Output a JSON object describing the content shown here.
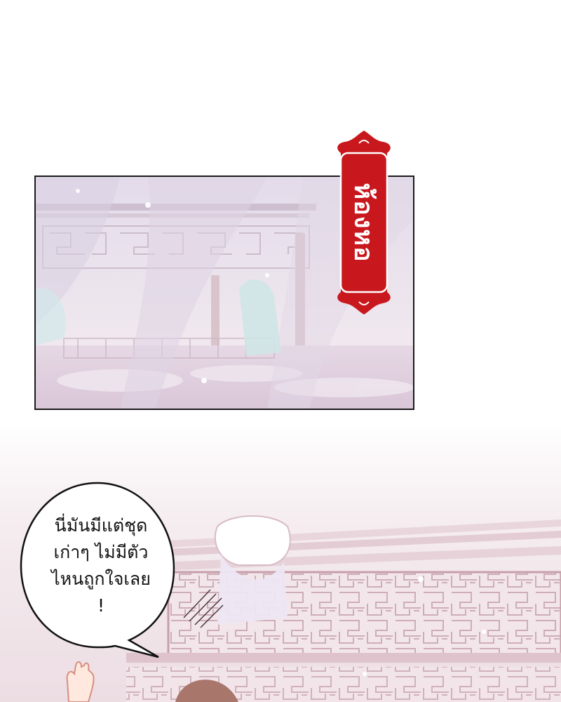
{
  "location_sign": {
    "text": "ห้องหอ",
    "background_color": "#c8181d",
    "text_color": "#ffffff"
  },
  "speech_bubble": {
    "lines": [
      "นี่มันมีแต่ชุด",
      "เก่าๆ ไม่มีตัว",
      "ไหนถูกใจเลย",
      "!"
    ]
  }
}
